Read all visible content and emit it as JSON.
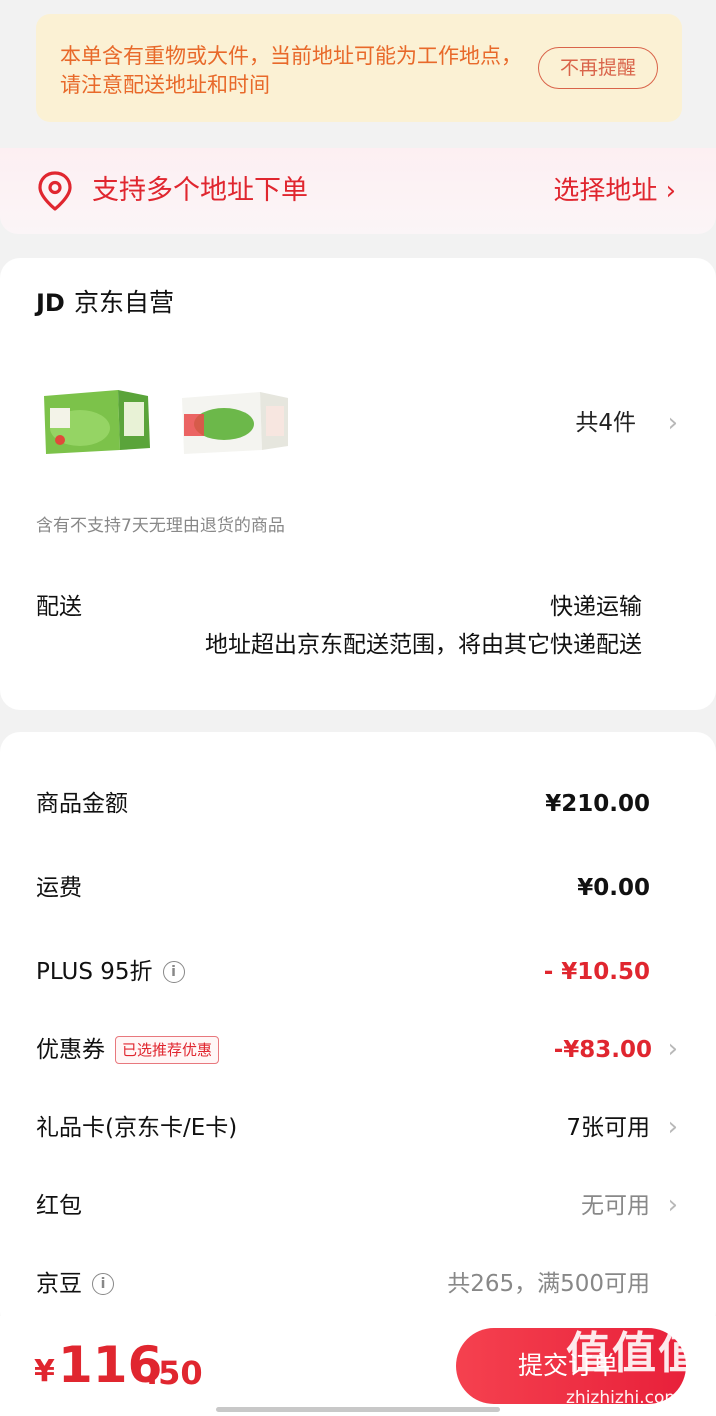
{
  "notice": {
    "text": "本单含有重物或大件，当前地址可能为工作地点，请注意配送地址和时间",
    "dismiss_label": "不再提醒"
  },
  "address": {
    "label": "支持多个地址下单",
    "select_label": "选择地址 ›",
    "icon": "location-pin-icon"
  },
  "shop": {
    "logo": "JD",
    "name": "京东自营",
    "item_count": "共4件",
    "return_note": "含有不支持7天无理由退货的商品",
    "delivery_label": "配送",
    "delivery_method": "快递运输",
    "delivery_desc": "地址超出京东配送范围，将由其它快递配送"
  },
  "summary": {
    "rows": [
      {
        "label": "商品金额",
        "value": "¥210.00"
      },
      {
        "label": "运费",
        "value": "¥0.00"
      },
      {
        "label": "PLUS 95折",
        "value": "- ¥10.50"
      },
      {
        "label": "优惠券",
        "tag": "已选推荐优惠",
        "value": "-¥83.00"
      },
      {
        "label": "礼品卡(京东卡/E卡)",
        "value": "7张可用"
      },
      {
        "label": "红包",
        "value": "无可用"
      },
      {
        "label": "京豆",
        "value": "共265，满500可用"
      }
    ]
  },
  "bottom": {
    "currency": "¥",
    "total_int": "116",
    "total_dec": ".50",
    "submit_label": "提交订单"
  },
  "watermark": {
    "logo": "值值值",
    "url": "zhizhizhi.com"
  },
  "colors": {
    "accent_red": "#e0262f",
    "notice_bg": "#fbf1d4",
    "notice_text": "#e8692a"
  }
}
